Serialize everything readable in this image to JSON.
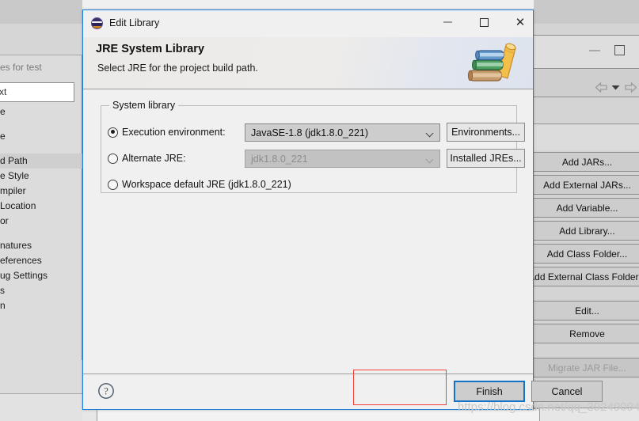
{
  "dialog": {
    "title": "Edit Library",
    "icon": "eclipse-icon",
    "header_title": "JRE System Library",
    "header_subtitle": "Select JRE for the project build path.",
    "header_icon": "books-icon",
    "window_controls": {
      "minimize": "—",
      "maximize": "□",
      "close": "✕"
    },
    "group": {
      "legend": "System library",
      "options": [
        {
          "label": "Execution environment:",
          "selected": true,
          "combo_value": "JavaSE-1.8 (jdk1.8.0_221)",
          "combo_enabled": true,
          "button": "Environments..."
        },
        {
          "label": "Alternate JRE:",
          "selected": false,
          "combo_value": "jdk1.8.0_221",
          "combo_enabled": false,
          "button": "Installed JREs..."
        },
        {
          "label": "Workspace default JRE (jdk1.8.0_221)",
          "selected": false
        }
      ]
    },
    "footer": {
      "help_icon": "question-mark-icon",
      "finish_label": "Finish",
      "cancel_label": "Cancel"
    }
  },
  "background": {
    "left_panel": {
      "sub_label": "es for test",
      "textbox_value": "xt",
      "tree_items": [
        {
          "label": "e",
          "selected": false
        },
        {
          "label": "e",
          "selected": false
        },
        {
          "label": "d Path",
          "selected": true
        },
        {
          "label": "e Style",
          "selected": false
        },
        {
          "label": "mpiler",
          "selected": false
        },
        {
          "label": "Location",
          "selected": false
        },
        {
          "label": "or",
          "selected": false
        },
        {
          "label": "natures",
          "selected": false
        },
        {
          "label": "eferences",
          "selected": false
        },
        {
          "label": "ug Settings",
          "selected": false
        },
        {
          "label": "s",
          "selected": false
        },
        {
          "label": "n",
          "selected": false
        }
      ]
    },
    "right_buttons": [
      {
        "label": "Add JARs...",
        "enabled": true
      },
      {
        "label": "Add External JARs...",
        "enabled": true
      },
      {
        "label": "Add Variable...",
        "enabled": true
      },
      {
        "label": "Add Library...",
        "enabled": true
      },
      {
        "label": "Add Class Folder...",
        "enabled": true
      },
      {
        "label": "Add External Class Folder...",
        "enabled": true
      },
      {
        "label": "Edit...",
        "enabled": true
      },
      {
        "label": "Remove",
        "enabled": true
      },
      {
        "label": "Migrate JAR File...",
        "enabled": false
      }
    ],
    "nav": {
      "back_icon": "arrow-left-icon",
      "dropdown_icon": "chevron-down-icon",
      "forward_icon": "arrow-right-icon"
    }
  },
  "annotation": {
    "highlight_target": "Finish",
    "color": "#f0403a"
  },
  "watermark": {
    "text": "https://blog.csdn.net/qq_39249094"
  }
}
